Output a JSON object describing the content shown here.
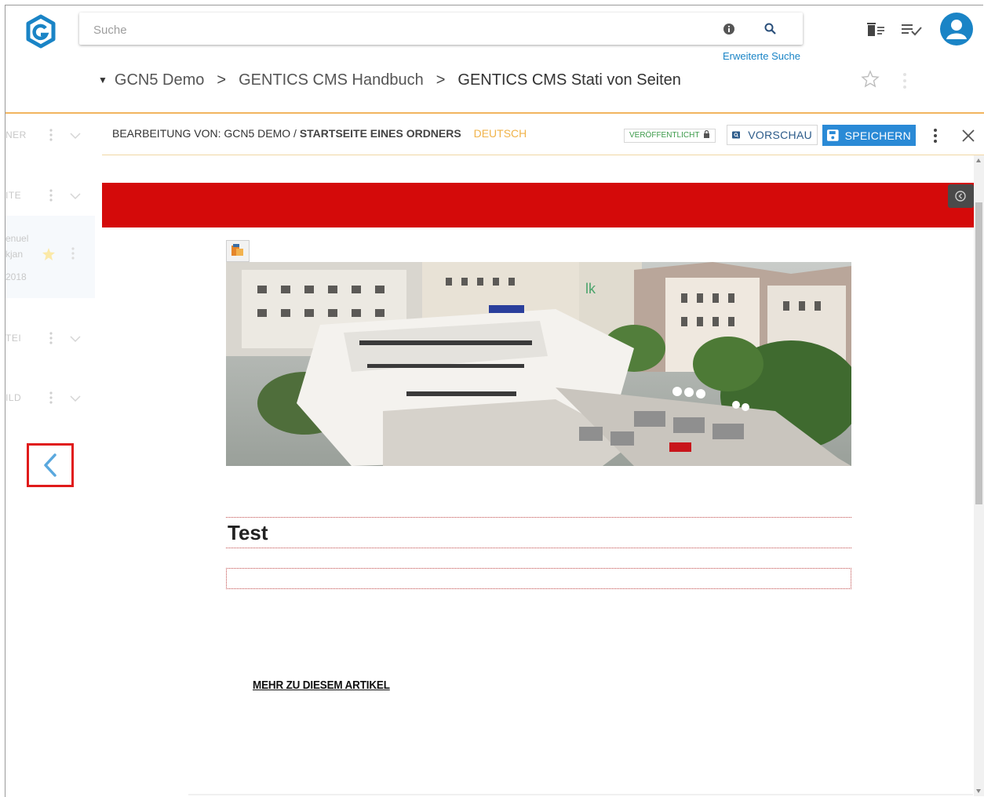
{
  "search": {
    "placeholder": "Suche",
    "advanced_link": "Erweiterte Suche"
  },
  "breadcrumb": {
    "items": [
      "GCN5 Demo",
      "GENTICS CMS Handbuch",
      "GENTICS CMS Stati von Seiten"
    ]
  },
  "left_panel": {
    "sections": [
      "NER",
      "ITE",
      "TEI",
      "ILD"
    ],
    "item": {
      "line1": "enuel",
      "line2": "kjan",
      "line3": "2018"
    }
  },
  "editor": {
    "prefix": "BEARBEITUNG VON:",
    "node": "GCN5 DEMO",
    "separator": "/",
    "page": "STARTSEITE EINES ORDNERS",
    "language": "DEUTSCH",
    "status": "VERÖFFENTLICHT",
    "preview_label": "VORSCHAU",
    "save_label": "SPEICHERN"
  },
  "content": {
    "heading": "Test",
    "more_link": "MEHR ZU DIESEM ARTIKEL"
  },
  "colors": {
    "accent": "#1a84c6",
    "banner": "#d40a0a",
    "language": "#f0b34a",
    "save_button": "#2a8ad6",
    "highlight_box": "#e01b1b"
  },
  "icons": [
    "logo-icon",
    "info-icon",
    "search-icon",
    "trash-icon",
    "queue-icon",
    "user-avatar-icon",
    "star-icon",
    "more-vert-icon",
    "preview-icon",
    "save-icon",
    "close-icon",
    "chevron-left-icon",
    "image-tag-icon"
  ]
}
